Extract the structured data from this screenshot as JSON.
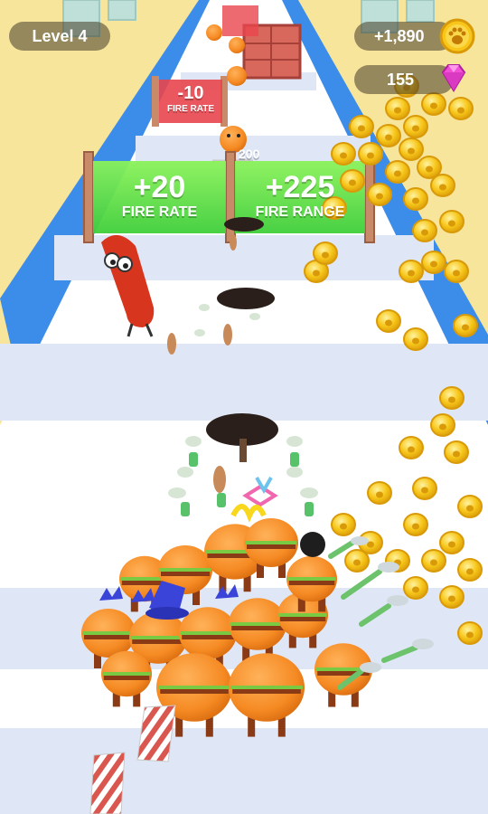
{
  "hud": {
    "level_label": "Level 4",
    "coins": "+1,890",
    "coin_icon": "paw-coin-icon",
    "gems": "155",
    "gem_icon": "pink-gem-icon"
  },
  "gates": {
    "far_gate": {
      "value": "-10",
      "label": "FIRE RATE"
    },
    "left_gate": {
      "value": "+20",
      "label": "FIRE RATE"
    },
    "right_gate": {
      "value": "+225",
      "label": "FIRE RANGE"
    }
  },
  "enemy_hp": "200",
  "colors": {
    "sky": "#f7e59b",
    "track_white": "#ffffff",
    "track_stripe": "#dfe7f6",
    "rail_blue": "#3c8dea",
    "gate_green": "#5de14a",
    "gate_red": "#e8454d",
    "coin_gold": "#f7c619",
    "burger_orange": "#f58a23"
  }
}
